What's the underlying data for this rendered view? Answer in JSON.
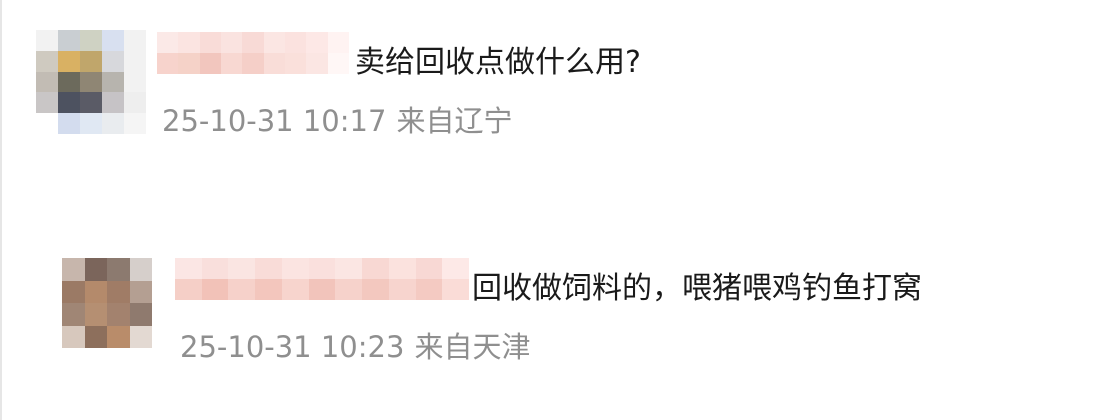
{
  "comments": [
    {
      "text": "卖给回收点做什么用?",
      "date": "25-10-31 10:17",
      "location": "来自辽宁"
    },
    {
      "text": "回收做饲料的，喂猪喂鸡钓鱼打窝",
      "date": "25-10-31 10:23",
      "location": "来自天津"
    }
  ]
}
